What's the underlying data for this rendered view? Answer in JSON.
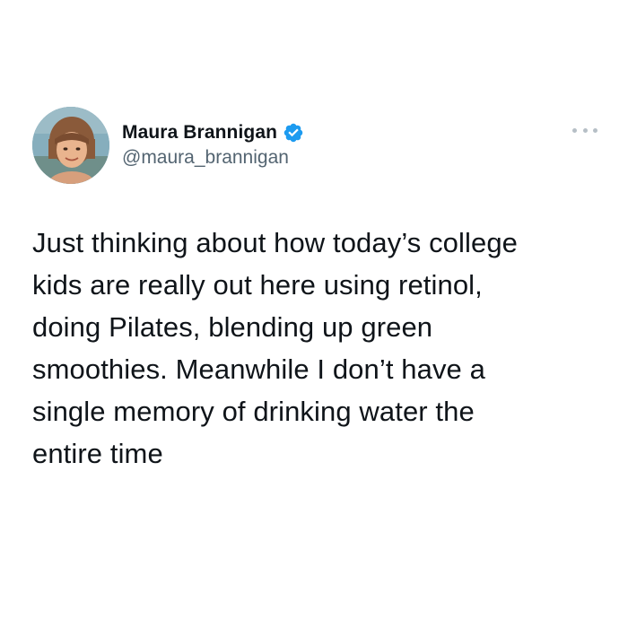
{
  "author": {
    "display_name": "Maura Brannigan",
    "handle": "@maura_brannigan",
    "verified": true,
    "verified_color": "#1d9bf0"
  },
  "tweet": {
    "text": "Just thinking about how today’s college\nkids are really out here using retinol,\ndoing Pilates, blending up green\nsmoothies. Meanwhile I don’t have a\nsingle memory of drinking water the\nentire time"
  },
  "icons": {
    "more": "more-options-icon",
    "verified": "verified-badge-icon"
  },
  "colors": {
    "text_primary": "#0f1419",
    "text_secondary": "#536471",
    "background": "#ffffff"
  }
}
